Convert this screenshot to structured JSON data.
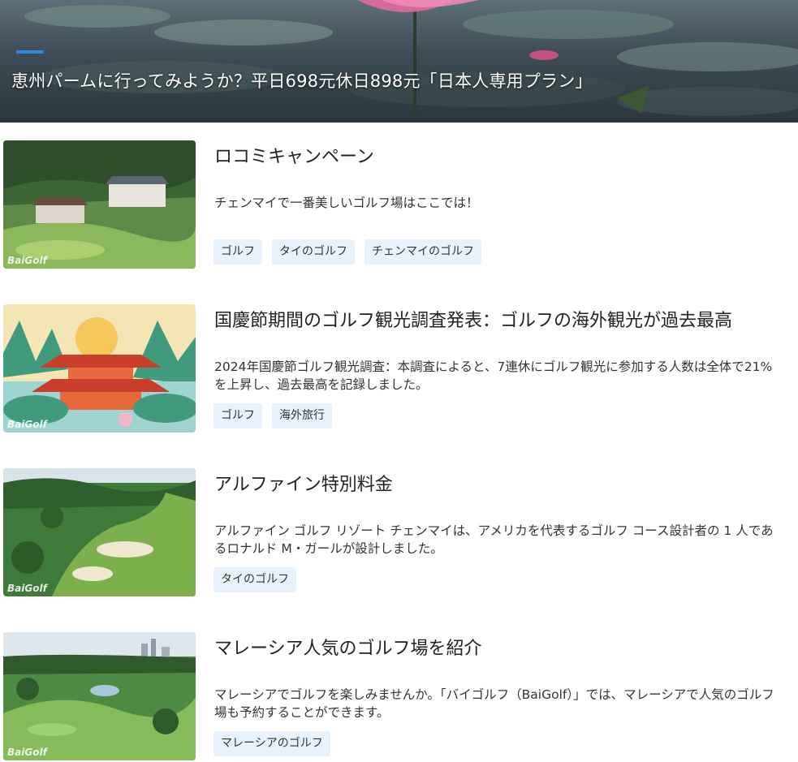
{
  "hero": {
    "title": "恵州パームに行ってみようか？平日698元休日898元「日本人専用プラン」",
    "indicator_color": "#2f86e8"
  },
  "watermark": "BaiGolf",
  "articles": [
    {
      "title": "ロコミキャンペーン",
      "description": "チェンマイで一番美しいゴルフ場はここでは！",
      "tags": [
        "ゴルフ",
        "タイのゴルフ",
        "チェンマイのゴルフ"
      ]
    },
    {
      "title": "国慶節期間のゴルフ観光調査発表：ゴルフの海外観光が過去最高",
      "description": "2024年国慶節ゴルフ観光調査：本調査によると、7連休にゴルフ観光に参加する人数は全体で21%を上昇し、過去最高を記録しました。",
      "tags": [
        "ゴルフ",
        "海外旅行"
      ]
    },
    {
      "title": "アルファイン特別料金",
      "description": "アルファイン ゴルフ リゾート チェンマイは、アメリカを代表するゴルフ コース設計者の 1 人であるロナルド M・ガールが設計しました。",
      "tags": [
        "タイのゴルフ"
      ]
    },
    {
      "title": "マレーシア人気のゴルフ場を紹介",
      "description": "マレーシアでゴルフを楽しみませんか。「バイゴルフ（BaiGolf）」では、マレーシアで人気のゴルフ場も予約することができます。",
      "tags": [
        "マレーシアのゴルフ"
      ]
    }
  ],
  "colors": {
    "tag_background": "#e8f2fd",
    "text": "#222222"
  }
}
